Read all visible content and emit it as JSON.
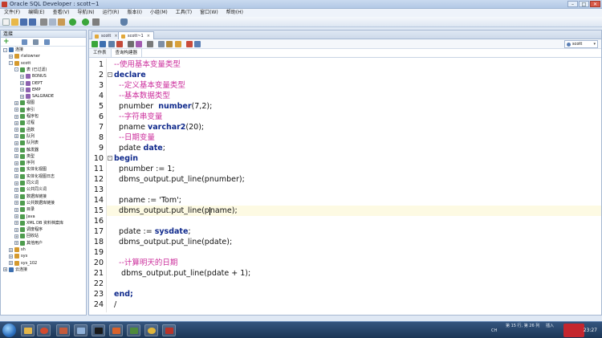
{
  "window": {
    "title": "Oracle SQL Developer : scott~1"
  },
  "menu": [
    "文件(F)",
    "编辑(E)",
    "查看(V)",
    "导航(N)",
    "运行(R)",
    "版本(I)",
    "小组(M)",
    "工具(T)",
    "窗口(W)",
    "帮助(H)"
  ],
  "sidebar": {
    "title": "连接",
    "tree": [
      {
        "label": "连接",
        "level": 0,
        "exp": "-"
      },
      {
        "label": "rlatowner",
        "level": 1,
        "exp": "+"
      },
      {
        "label": "scott",
        "level": 1,
        "exp": "-"
      },
      {
        "label": "表 (已过滤)",
        "level": 2,
        "exp": "-"
      },
      {
        "label": "BONUS",
        "level": 3,
        "exp": "+"
      },
      {
        "label": "DEPT",
        "level": 3,
        "exp": "+"
      },
      {
        "label": "EMP",
        "level": 3,
        "exp": "+"
      },
      {
        "label": "SALGRADE",
        "level": 3,
        "exp": "+"
      },
      {
        "label": "视图",
        "level": 2,
        "exp": "+"
      },
      {
        "label": "索引",
        "level": 2,
        "exp": "+"
      },
      {
        "label": "程序包",
        "level": 2,
        "exp": "+"
      },
      {
        "label": "过程",
        "level": 2,
        "exp": "+"
      },
      {
        "label": "函数",
        "level": 2,
        "exp": "+"
      },
      {
        "label": "队列",
        "level": 2,
        "exp": "+"
      },
      {
        "label": "队列表",
        "level": 2,
        "exp": "+"
      },
      {
        "label": "触发器",
        "level": 2,
        "exp": "+"
      },
      {
        "label": "类型",
        "level": 2,
        "exp": "+"
      },
      {
        "label": "序列",
        "level": 2,
        "exp": "+"
      },
      {
        "label": "实体化视图",
        "level": 2,
        "exp": "+"
      },
      {
        "label": "实体化视图日志",
        "level": 2,
        "exp": "+"
      },
      {
        "label": "同义词",
        "level": 2,
        "exp": "+"
      },
      {
        "label": "公共同义词",
        "level": 2,
        "exp": "+"
      },
      {
        "label": "数据库链接",
        "level": 2,
        "exp": "+"
      },
      {
        "label": "公共数据库链接",
        "level": 2,
        "exp": "+"
      },
      {
        "label": "目录",
        "level": 2,
        "exp": "+"
      },
      {
        "label": "Java",
        "level": 2,
        "exp": "+"
      },
      {
        "label": "XML DB 资料档案库",
        "level": 2,
        "exp": "+"
      },
      {
        "label": "调度程序",
        "level": 2,
        "exp": "+"
      },
      {
        "label": "回收站",
        "level": 2,
        "exp": "+"
      },
      {
        "label": "其他用户",
        "level": 2,
        "exp": "+"
      },
      {
        "label": "sh",
        "level": 1,
        "exp": "+"
      },
      {
        "label": "sys",
        "level": 1,
        "exp": "+"
      },
      {
        "label": "sys_102",
        "level": 1,
        "exp": "+"
      },
      {
        "label": "云连接",
        "level": 0,
        "exp": "+"
      }
    ]
  },
  "tabs": [
    {
      "label": "scott",
      "active": false
    },
    {
      "label": "scott~1",
      "active": true
    }
  ],
  "connection": {
    "value": "scott"
  },
  "subtabs": [
    "工作表",
    "查询构建器"
  ],
  "editor": {
    "lines": [
      {
        "n": "1",
        "tokens": [
          {
            "t": "--使用基本变量类型",
            "c": "cm"
          }
        ]
      },
      {
        "n": "2",
        "fold": "-",
        "tokens": [
          {
            "t": "declare",
            "c": "kw"
          }
        ]
      },
      {
        "n": "3",
        "tokens": [
          {
            "t": "  --定义基本变量类型",
            "c": "cm"
          }
        ]
      },
      {
        "n": "4",
        "tokens": [
          {
            "t": "  --基本数据类型",
            "c": "cm"
          }
        ]
      },
      {
        "n": "5",
        "tokens": [
          {
            "t": "  pnumber  ",
            "c": ""
          },
          {
            "t": "number",
            "c": "kw"
          },
          {
            "t": "(7,2);",
            "c": ""
          }
        ]
      },
      {
        "n": "6",
        "tokens": [
          {
            "t": "  --字符串变量",
            "c": "cm"
          }
        ]
      },
      {
        "n": "7",
        "tokens": [
          {
            "t": "  pname ",
            "c": ""
          },
          {
            "t": "varchar2",
            "c": "kw"
          },
          {
            "t": "(20);",
            "c": ""
          }
        ]
      },
      {
        "n": "8",
        "tokens": [
          {
            "t": "  --日期变量",
            "c": "cm"
          }
        ]
      },
      {
        "n": "9",
        "tokens": [
          {
            "t": "  pdate ",
            "c": ""
          },
          {
            "t": "date",
            "c": "kw"
          },
          {
            "t": ";",
            "c": ""
          }
        ]
      },
      {
        "n": "10",
        "fold": "-",
        "tokens": [
          {
            "t": "begin",
            "c": "kw"
          }
        ]
      },
      {
        "n": "11",
        "tokens": [
          {
            "t": "  pnumber := 1;",
            "c": ""
          }
        ]
      },
      {
        "n": "12",
        "tokens": [
          {
            "t": "  dbms_output.put_line(pnumber);",
            "c": ""
          }
        ]
      },
      {
        "n": "13",
        "tokens": [
          {
            "t": "",
            "c": ""
          }
        ]
      },
      {
        "n": "14",
        "tokens": [
          {
            "t": "  pname := 'Tom';",
            "c": ""
          }
        ]
      },
      {
        "n": "15",
        "tokens": [
          {
            "t": "  dbms_output.put_line(p",
            "c": ""
          },
          {
            "t": "|",
            "c": "caret"
          },
          {
            "t": "name);",
            "c": ""
          }
        ]
      },
      {
        "n": "16",
        "tokens": [
          {
            "t": "",
            "c": ""
          }
        ]
      },
      {
        "n": "17",
        "tokens": [
          {
            "t": "  pdate := ",
            "c": ""
          },
          {
            "t": "sysdate",
            "c": "kw"
          },
          {
            "t": ";",
            "c": ""
          }
        ]
      },
      {
        "n": "18",
        "tokens": [
          {
            "t": "  dbms_output.put_line(pdate);",
            "c": ""
          }
        ]
      },
      {
        "n": "19",
        "tokens": [
          {
            "t": "",
            "c": ""
          }
        ]
      },
      {
        "n": "20",
        "tokens": [
          {
            "t": "  --计算明天的日期",
            "c": "cm"
          }
        ]
      },
      {
        "n": "21",
        "tokens": [
          {
            "t": "   dbms_output.put_line(pdate + 1);",
            "c": ""
          }
        ]
      },
      {
        "n": "22",
        "tokens": [
          {
            "t": "",
            "c": ""
          }
        ]
      },
      {
        "n": "23",
        "tokens": [
          {
            "t": "end;",
            "c": "kw"
          }
        ]
      },
      {
        "n": "24",
        "tokens": [
          {
            "t": "/",
            "c": ""
          }
        ]
      }
    ],
    "current_line": "15"
  },
  "tray": {
    "ime": "CH",
    "status": "第 15 行, 第 26 列",
    "mode": "插入",
    "clock": "23:27"
  },
  "colors": {
    "keyword": "#102a8c",
    "comment": "#cc2f9c",
    "current_line": "#fdfae3"
  }
}
